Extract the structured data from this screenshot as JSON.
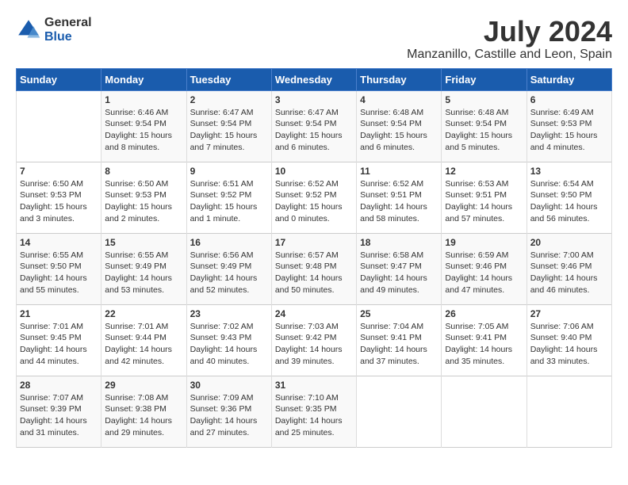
{
  "header": {
    "logo_line1": "General",
    "logo_line2": "Blue",
    "month_year": "July 2024",
    "location": "Manzanillo, Castille and Leon, Spain"
  },
  "days_of_week": [
    "Sunday",
    "Monday",
    "Tuesday",
    "Wednesday",
    "Thursday",
    "Friday",
    "Saturday"
  ],
  "weeks": [
    [
      {
        "day": "",
        "sunrise": "",
        "sunset": "",
        "daylight": ""
      },
      {
        "day": "1",
        "sunrise": "Sunrise: 6:46 AM",
        "sunset": "Sunset: 9:54 PM",
        "daylight": "Daylight: 15 hours and 8 minutes."
      },
      {
        "day": "2",
        "sunrise": "Sunrise: 6:47 AM",
        "sunset": "Sunset: 9:54 PM",
        "daylight": "Daylight: 15 hours and 7 minutes."
      },
      {
        "day": "3",
        "sunrise": "Sunrise: 6:47 AM",
        "sunset": "Sunset: 9:54 PM",
        "daylight": "Daylight: 15 hours and 6 minutes."
      },
      {
        "day": "4",
        "sunrise": "Sunrise: 6:48 AM",
        "sunset": "Sunset: 9:54 PM",
        "daylight": "Daylight: 15 hours and 6 minutes."
      },
      {
        "day": "5",
        "sunrise": "Sunrise: 6:48 AM",
        "sunset": "Sunset: 9:54 PM",
        "daylight": "Daylight: 15 hours and 5 minutes."
      },
      {
        "day": "6",
        "sunrise": "Sunrise: 6:49 AM",
        "sunset": "Sunset: 9:53 PM",
        "daylight": "Daylight: 15 hours and 4 minutes."
      }
    ],
    [
      {
        "day": "7",
        "sunrise": "Sunrise: 6:50 AM",
        "sunset": "Sunset: 9:53 PM",
        "daylight": "Daylight: 15 hours and 3 minutes."
      },
      {
        "day": "8",
        "sunrise": "Sunrise: 6:50 AM",
        "sunset": "Sunset: 9:53 PM",
        "daylight": "Daylight: 15 hours and 2 minutes."
      },
      {
        "day": "9",
        "sunrise": "Sunrise: 6:51 AM",
        "sunset": "Sunset: 9:52 PM",
        "daylight": "Daylight: 15 hours and 1 minute."
      },
      {
        "day": "10",
        "sunrise": "Sunrise: 6:52 AM",
        "sunset": "Sunset: 9:52 PM",
        "daylight": "Daylight: 15 hours and 0 minutes."
      },
      {
        "day": "11",
        "sunrise": "Sunrise: 6:52 AM",
        "sunset": "Sunset: 9:51 PM",
        "daylight": "Daylight: 14 hours and 58 minutes."
      },
      {
        "day": "12",
        "sunrise": "Sunrise: 6:53 AM",
        "sunset": "Sunset: 9:51 PM",
        "daylight": "Daylight: 14 hours and 57 minutes."
      },
      {
        "day": "13",
        "sunrise": "Sunrise: 6:54 AM",
        "sunset": "Sunset: 9:50 PM",
        "daylight": "Daylight: 14 hours and 56 minutes."
      }
    ],
    [
      {
        "day": "14",
        "sunrise": "Sunrise: 6:55 AM",
        "sunset": "Sunset: 9:50 PM",
        "daylight": "Daylight: 14 hours and 55 minutes."
      },
      {
        "day": "15",
        "sunrise": "Sunrise: 6:55 AM",
        "sunset": "Sunset: 9:49 PM",
        "daylight": "Daylight: 14 hours and 53 minutes."
      },
      {
        "day": "16",
        "sunrise": "Sunrise: 6:56 AM",
        "sunset": "Sunset: 9:49 PM",
        "daylight": "Daylight: 14 hours and 52 minutes."
      },
      {
        "day": "17",
        "sunrise": "Sunrise: 6:57 AM",
        "sunset": "Sunset: 9:48 PM",
        "daylight": "Daylight: 14 hours and 50 minutes."
      },
      {
        "day": "18",
        "sunrise": "Sunrise: 6:58 AM",
        "sunset": "Sunset: 9:47 PM",
        "daylight": "Daylight: 14 hours and 49 minutes."
      },
      {
        "day": "19",
        "sunrise": "Sunrise: 6:59 AM",
        "sunset": "Sunset: 9:46 PM",
        "daylight": "Daylight: 14 hours and 47 minutes."
      },
      {
        "day": "20",
        "sunrise": "Sunrise: 7:00 AM",
        "sunset": "Sunset: 9:46 PM",
        "daylight": "Daylight: 14 hours and 46 minutes."
      }
    ],
    [
      {
        "day": "21",
        "sunrise": "Sunrise: 7:01 AM",
        "sunset": "Sunset: 9:45 PM",
        "daylight": "Daylight: 14 hours and 44 minutes."
      },
      {
        "day": "22",
        "sunrise": "Sunrise: 7:01 AM",
        "sunset": "Sunset: 9:44 PM",
        "daylight": "Daylight: 14 hours and 42 minutes."
      },
      {
        "day": "23",
        "sunrise": "Sunrise: 7:02 AM",
        "sunset": "Sunset: 9:43 PM",
        "daylight": "Daylight: 14 hours and 40 minutes."
      },
      {
        "day": "24",
        "sunrise": "Sunrise: 7:03 AM",
        "sunset": "Sunset: 9:42 PM",
        "daylight": "Daylight: 14 hours and 39 minutes."
      },
      {
        "day": "25",
        "sunrise": "Sunrise: 7:04 AM",
        "sunset": "Sunset: 9:41 PM",
        "daylight": "Daylight: 14 hours and 37 minutes."
      },
      {
        "day": "26",
        "sunrise": "Sunrise: 7:05 AM",
        "sunset": "Sunset: 9:41 PM",
        "daylight": "Daylight: 14 hours and 35 minutes."
      },
      {
        "day": "27",
        "sunrise": "Sunrise: 7:06 AM",
        "sunset": "Sunset: 9:40 PM",
        "daylight": "Daylight: 14 hours and 33 minutes."
      }
    ],
    [
      {
        "day": "28",
        "sunrise": "Sunrise: 7:07 AM",
        "sunset": "Sunset: 9:39 PM",
        "daylight": "Daylight: 14 hours and 31 minutes."
      },
      {
        "day": "29",
        "sunrise": "Sunrise: 7:08 AM",
        "sunset": "Sunset: 9:38 PM",
        "daylight": "Daylight: 14 hours and 29 minutes."
      },
      {
        "day": "30",
        "sunrise": "Sunrise: 7:09 AM",
        "sunset": "Sunset: 9:36 PM",
        "daylight": "Daylight: 14 hours and 27 minutes."
      },
      {
        "day": "31",
        "sunrise": "Sunrise: 7:10 AM",
        "sunset": "Sunset: 9:35 PM",
        "daylight": "Daylight: 14 hours and 25 minutes."
      },
      {
        "day": "",
        "sunrise": "",
        "sunset": "",
        "daylight": ""
      },
      {
        "day": "",
        "sunrise": "",
        "sunset": "",
        "daylight": ""
      },
      {
        "day": "",
        "sunrise": "",
        "sunset": "",
        "daylight": ""
      }
    ]
  ]
}
